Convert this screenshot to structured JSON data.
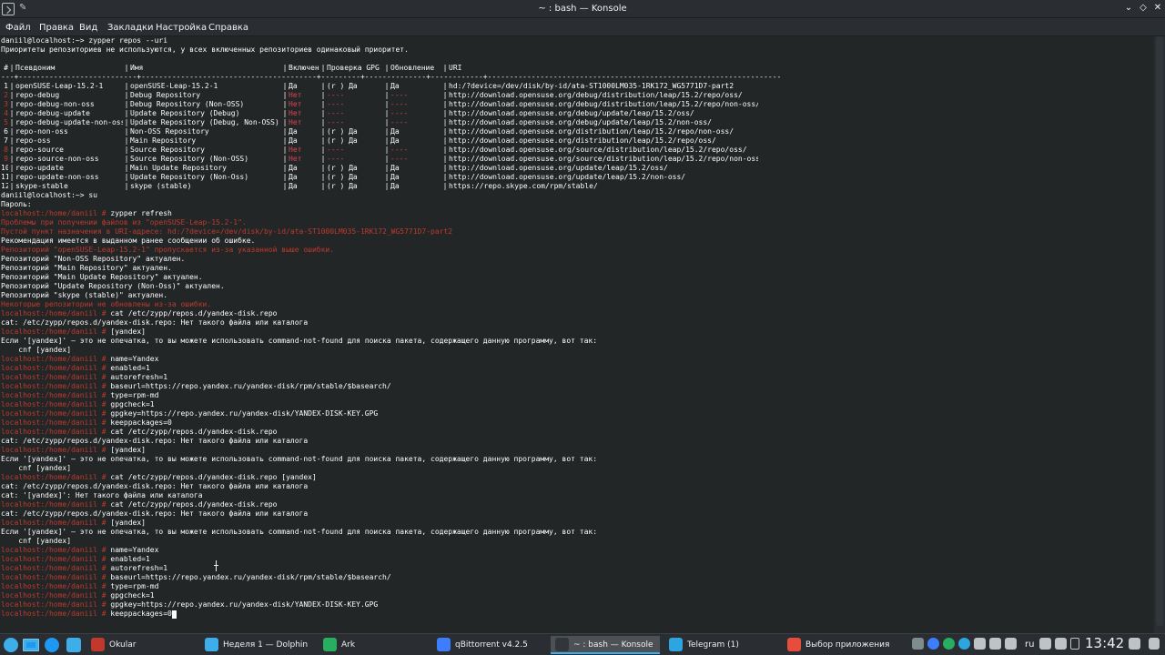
{
  "window": {
    "title": "~ : bash — Konsole"
  },
  "menu": [
    "Файл",
    "Правка",
    "Вид",
    "Закладки",
    "Настройка",
    "Справка"
  ],
  "colors": {
    "prompt_red": "#c0392b",
    "error_red": "#da4453",
    "terminal_bg": "#232627",
    "text": "#fcfcfc",
    "accent": "#3daee9"
  },
  "terminal": {
    "before_table": [
      {
        "kind": "plain",
        "text": "daniil@localhost:~> zypper repos --uri"
      },
      {
        "kind": "plain",
        "text": "Приоритеты репозиториев не используются, у всех включенных репозиториев одинаковый приоритет."
      },
      {
        "kind": "plain",
        "text": ""
      }
    ],
    "table": {
      "headers": [
        "#",
        "Псевдоним",
        "Имя",
        "Включен",
        "Проверка GPG",
        "Обновление",
        "URI"
      ],
      "rule": "---+---------------------------+----------------------------------------+---------+--------------+------------+-------------------------------------------------------------------",
      "rows": [
        [
          "1",
          "openSUSE-Leap-15.2-1",
          "openSUSE-Leap-15.2-1",
          "Да",
          "(r ) Да",
          "Да",
          "hd:/?device=/dev/disk/by-id/ata-ST1000LM035-1RK172_WG5771D7-part2"
        ],
        [
          "2",
          "repo-debug",
          "Debug Repository",
          "Нет",
          "----",
          "----",
          "http://download.opensuse.org/debug/distribution/leap/15.2/repo/oss/"
        ],
        [
          "3",
          "repo-debug-non-oss",
          "Debug Repository (Non-OSS)",
          "Нет",
          "----",
          "----",
          "http://download.opensuse.org/debug/distribution/leap/15.2/repo/non-oss/"
        ],
        [
          "4",
          "repo-debug-update",
          "Update Repository (Debug)",
          "Нет",
          "----",
          "----",
          "http://download.opensuse.org/debug/update/leap/15.2/oss/"
        ],
        [
          "5",
          "repo-debug-update-non-oss",
          "Update Repository (Debug, Non-OSS)",
          "Нет",
          "----",
          "----",
          "http://download.opensuse.org/debug/update/leap/15.2/non-oss/"
        ],
        [
          "6",
          "repo-non-oss",
          "Non-OSS Repository",
          "Да",
          "(r ) Да",
          "Да",
          "http://download.opensuse.org/distribution/leap/15.2/repo/non-oss/"
        ],
        [
          "7",
          "repo-oss",
          "Main Repository",
          "Да",
          "(r ) Да",
          "Да",
          "http://download.opensuse.org/distribution/leap/15.2/repo/oss/"
        ],
        [
          "8",
          "repo-source",
          "Source Repository",
          "Нет",
          "----",
          "----",
          "http://download.opensuse.org/source/distribution/leap/15.2/repo/oss/"
        ],
        [
          "9",
          "repo-source-non-oss",
          "Source Repository (Non-OSS)",
          "Нет",
          "----",
          "----",
          "http://download.opensuse.org/source/distribution/leap/15.2/repo/non-oss/"
        ],
        [
          "10",
          "repo-update",
          "Main Update Repository",
          "Да",
          "(r ) Да",
          "Да",
          "http://download.opensuse.org/update/leap/15.2/oss/"
        ],
        [
          "11",
          "repo-update-non-oss",
          "Update Repository (Non-Oss)",
          "Да",
          "(r ) Да",
          "Да",
          "http://download.opensuse.org/update/leap/15.2/non-oss/"
        ],
        [
          "12",
          "skype-stable",
          "skype (stable)",
          "Да",
          "(r ) Да",
          "Да",
          "https://repo.skype.com/rpm/stable/"
        ]
      ]
    },
    "after_table": [
      {
        "kind": "plain",
        "text": "daniil@localhost:~> su"
      },
      {
        "kind": "plain",
        "text": "Пароль:"
      },
      {
        "kind": "prompt",
        "prompt": "localhost:/home/daniil # ",
        "text": "zypper refresh"
      },
      {
        "kind": "red",
        "text": "Проблемы при получении файлов из \"openSUSE-Leap-15.2-1\"."
      },
      {
        "kind": "red",
        "text": "Пустой пункт назначения в URI-адресе: hd:/?device=/dev/disk/by-id/ata-ST1000LM035-1RK172_WG5771D7-part2"
      },
      {
        "kind": "plain",
        "text": "Рекомендация имеется в выданном ранее сообщении об ошибке."
      },
      {
        "kind": "red",
        "text": "Репозиторий \"openSUSE-Leap-15.2-1\" пропускается из-за указанной выше ошибки."
      },
      {
        "kind": "plain",
        "text": "Репозиторий \"Non-OSS Repository\" актуален."
      },
      {
        "kind": "plain",
        "text": "Репозиторий \"Main Repository\" актуален."
      },
      {
        "kind": "plain",
        "text": "Репозиторий \"Main Update Repository\" актуален."
      },
      {
        "kind": "plain",
        "text": "Репозиторий \"Update Repository (Non-Oss)\" актуален."
      },
      {
        "kind": "plain",
        "text": "Репозиторий \"skype (stable)\" актуален."
      },
      {
        "kind": "red",
        "text": "Некоторые репозитории не обновлены из-за ошибки."
      },
      {
        "kind": "prompt",
        "prompt": "localhost:/home/daniil # ",
        "text": "cat /etc/zypp/repos.d/yandex-disk.repo"
      },
      {
        "kind": "plain",
        "text": "cat: /etc/zypp/repos.d/yandex-disk.repo: Нет такого файла или каталога"
      },
      {
        "kind": "prompt",
        "prompt": "localhost:/home/daniil # ",
        "text": "[yandex]"
      },
      {
        "kind": "plain",
        "text": "Если '[yandex]' — это не опечатка, то вы можете использовать command-not-found для поиска пакета, содержащего данную программу, вот так:"
      },
      {
        "kind": "plain",
        "text": "    cnf [yandex]"
      },
      {
        "kind": "prompt",
        "prompt": "localhost:/home/daniil # ",
        "text": "name=Yandex"
      },
      {
        "kind": "prompt",
        "prompt": "localhost:/home/daniil # ",
        "text": "enabled=1"
      },
      {
        "kind": "prompt",
        "prompt": "localhost:/home/daniil # ",
        "text": "autorefresh=1"
      },
      {
        "kind": "prompt",
        "prompt": "localhost:/home/daniil # ",
        "text": "baseurl=https://repo.yandex.ru/yandex-disk/rpm/stable/$basearch/"
      },
      {
        "kind": "prompt",
        "prompt": "localhost:/home/daniil # ",
        "text": "type=rpm-md"
      },
      {
        "kind": "prompt",
        "prompt": "localhost:/home/daniil # ",
        "text": "gpgcheck=1"
      },
      {
        "kind": "prompt",
        "prompt": "localhost:/home/daniil # ",
        "text": "gpgkey=https://repo.yandex.ru/yandex-disk/YANDEX-DISK-KEY.GPG"
      },
      {
        "kind": "prompt",
        "prompt": "localhost:/home/daniil # ",
        "text": "keeppackages=0"
      },
      {
        "kind": "prompt",
        "prompt": "localhost:/home/daniil # ",
        "text": "cat /etc/zypp/repos.d/yandex-disk.repo"
      },
      {
        "kind": "plain",
        "text": "cat: /etc/zypp/repos.d/yandex-disk.repo: Нет такого файла или каталога"
      },
      {
        "kind": "prompt",
        "prompt": "localhost:/home/daniil # ",
        "text": "[yandex]"
      },
      {
        "kind": "plain",
        "text": "Если '[yandex]' — это не опечатка, то вы можете использовать command-not-found для поиска пакета, содержащего данную программу, вот так:"
      },
      {
        "kind": "plain",
        "text": "    cnf [yandex]"
      },
      {
        "kind": "prompt",
        "prompt": "localhost:/home/daniil # ",
        "text": "cat /etc/zypp/repos.d/yandex-disk.repo [yandex]"
      },
      {
        "kind": "plain",
        "text": "cat: /etc/zypp/repos.d/yandex-disk.repo: Нет такого файла или каталога"
      },
      {
        "kind": "plain",
        "text": "cat: '[yandex]': Нет такого файла или каталога"
      },
      {
        "kind": "prompt",
        "prompt": "localhost:/home/daniil # ",
        "text": "cat /etc/zypp/repos.d/yandex-disk.repo"
      },
      {
        "kind": "plain",
        "text": "cat: /etc/zypp/repos.d/yandex-disk.repo: Нет такого файла или каталога"
      },
      {
        "kind": "prompt",
        "prompt": "localhost:/home/daniil # ",
        "text": "[yandex]"
      },
      {
        "kind": "plain",
        "text": "Если '[yandex]' — это не опечатка, то вы можете использовать command-not-found для поиска пакета, содержащего данную программу, вот так:"
      },
      {
        "kind": "plain",
        "text": "    cnf [yandex]"
      },
      {
        "kind": "prompt",
        "prompt": "localhost:/home/daniil # ",
        "text": "name=Yandex"
      },
      {
        "kind": "prompt",
        "prompt": "localhost:/home/daniil # ",
        "text": "enabled=1"
      },
      {
        "kind": "prompt",
        "prompt": "localhost:/home/daniil # ",
        "text": "autorefresh=1"
      },
      {
        "kind": "prompt",
        "prompt": "localhost:/home/daniil # ",
        "text": "baseurl=https://repo.yandex.ru/yandex-disk/rpm/stable/$basearch/"
      },
      {
        "kind": "prompt",
        "prompt": "localhost:/home/daniil # ",
        "text": "type=rpm-md"
      },
      {
        "kind": "prompt",
        "prompt": "localhost:/home/daniil # ",
        "text": "gpgcheck=1"
      },
      {
        "kind": "prompt",
        "prompt": "localhost:/home/daniil # ",
        "text": "gpgkey=https://repo.yandex.ru/yandex-disk/YANDEX-DISK-KEY.GPG"
      },
      {
        "kind": "input",
        "prompt": "localhost:/home/daniil # ",
        "text": "keeppackages=0"
      }
    ]
  },
  "taskbar": {
    "tasks": [
      {
        "icon": "okular-icon",
        "label": "Okular",
        "active": false,
        "color": "#c0392b"
      },
      {
        "icon": "dolphin-icon",
        "label": "Неделя 1 — Dolphin",
        "active": false,
        "color": "#3daee9"
      },
      {
        "icon": "ark-icon",
        "label": "Ark",
        "active": false,
        "color": "#27ae60"
      },
      {
        "icon": "qbittorrent-icon",
        "label": "qBittorrent v4.2.5",
        "active": false,
        "color": "#3d7eff"
      },
      {
        "icon": "konsole-icon",
        "label": "~ : bash — Konsole",
        "active": true,
        "color": "#31363b"
      },
      {
        "icon": "telegram-icon",
        "label": "Telegram (1)",
        "active": false,
        "color": "#2ca5e0"
      },
      {
        "icon": "app-chooser-icon",
        "label": "Выбор приложения —…",
        "active": false,
        "color": "#e74c3c"
      }
    ],
    "keyboard_layout": "ru",
    "clock": "13:42"
  }
}
